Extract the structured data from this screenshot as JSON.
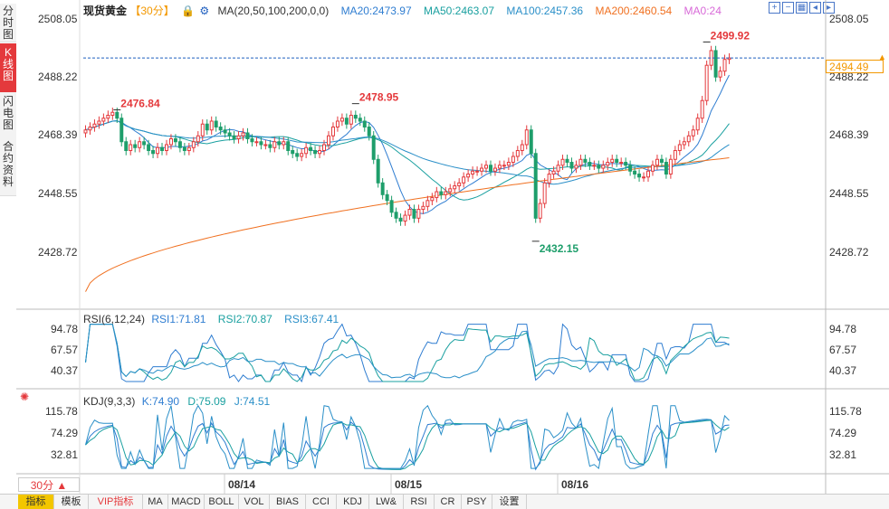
{
  "tabs": {
    "vertical": [
      {
        "label": "分时图",
        "active": false
      },
      {
        "label": "K线图",
        "active": true
      },
      {
        "label": "闪电图",
        "active": false
      },
      {
        "label": "合约资料",
        "active": false
      }
    ]
  },
  "main_legend": {
    "title": "现货黄金",
    "period": "【30分】",
    "ma_params": "MA(20,50,100,200,0,0)",
    "ma20": "MA20:2473.97",
    "ma50": "MA50:2463.07",
    "ma100": "MA100:2457.36",
    "ma200": "MA200:2460.54",
    "ma0": "MA0:24"
  },
  "rsi_legend": {
    "name": "RSI(6,12,24)",
    "rsi1": "RSI1:71.81",
    "rsi2": "RSI2:70.87",
    "rsi3": "RSI3:67.41"
  },
  "kdj_legend": {
    "name": "KDJ(9,3,3)",
    "k": "K:74.90",
    "d": "D:75.09",
    "j": "J:74.51"
  },
  "current_price": "2494.49",
  "period_button": "30分 ▲",
  "bottom_tabs": [
    "指标",
    "模板",
    "VIP指标",
    "MA",
    "MACD",
    "BOLL",
    "VOL",
    "BIAS",
    "CCI",
    "KDJ",
    "LW&",
    "RSI",
    "CR",
    "PSY",
    "设置"
  ],
  "colors": {
    "up": "#e4393c",
    "down": "#1e9e6b",
    "ma20": "#2f7dd1",
    "ma50": "#1aa0a0",
    "ma100": "#2a8fc8",
    "ma200": "#f07020",
    "price_line": "#1f5fbf",
    "accent": "#f39800"
  },
  "chart_data": [
    {
      "type": "candlestick",
      "title": "现货黄金 【30分】",
      "yaxis_ticks": [
        "2508.05",
        "2488.22",
        "2468.39",
        "2448.55",
        "2428.72"
      ],
      "ylim": [
        2415,
        2510
      ],
      "xaxis_ticks": [
        "08/14",
        "08/15",
        "08/16"
      ],
      "annotations": [
        {
          "label": "2476.84",
          "value": 2476.84,
          "type": "high"
        },
        {
          "label": "2478.95",
          "value": 2478.95,
          "type": "high"
        },
        {
          "label": "2432.15",
          "value": 2432.15,
          "type": "low"
        },
        {
          "label": "2499.92",
          "value": 2499.92,
          "type": "high"
        }
      ],
      "current_price": 2494.49,
      "closes": [
        2470,
        2471,
        2472,
        2473,
        2474,
        2475,
        2476,
        2474,
        2466,
        2463,
        2465,
        2464,
        2466,
        2465,
        2463,
        2462,
        2464,
        2463,
        2465,
        2467,
        2466,
        2464,
        2463,
        2464,
        2466,
        2468,
        2472,
        2470,
        2473,
        2471,
        2470,
        2469,
        2468,
        2467,
        2468,
        2469,
        2467,
        2466,
        2466,
        2465,
        2465,
        2464,
        2466,
        2465,
        2466,
        2463,
        2462,
        2461,
        2462,
        2464,
        2463,
        2462,
        2463,
        2465,
        2468,
        2471,
        2473,
        2474,
        2472,
        2475,
        2474,
        2473,
        2471,
        2468,
        2460,
        2452,
        2448,
        2446,
        2442,
        2440,
        2439,
        2441,
        2443,
        2440,
        2443,
        2444,
        2446,
        2447,
        2449,
        2448,
        2449,
        2450,
        2451,
        2452,
        2454,
        2455,
        2456,
        2456,
        2457,
        2458,
        2456,
        2457,
        2458,
        2458,
        2459,
        2461,
        2463,
        2465,
        2470,
        2462,
        2440,
        2445,
        2452,
        2455,
        2456,
        2458,
        2460,
        2459,
        2457,
        2458,
        2460,
        2459,
        2458,
        2458,
        2457,
        2458,
        2459,
        2460,
        2459,
        2459,
        2458,
        2456,
        2455,
        2454,
        2454,
        2456,
        2458,
        2460,
        2459,
        2455,
        2460,
        2463,
        2465,
        2466,
        2468,
        2470,
        2474,
        2480,
        2492,
        2497,
        2488,
        2490,
        2494,
        2494.49
      ]
    },
    {
      "type": "line",
      "title": "RSI(6,12,24)",
      "yaxis_ticks": [
        "94.78",
        "67.57",
        "40.37"
      ],
      "ylim": [
        25,
        105
      ],
      "series": [
        {
          "name": "RSI1",
          "latest": 71.81
        },
        {
          "name": "RSI2",
          "latest": 70.87
        },
        {
          "name": "RSI3",
          "latest": 67.41
        }
      ]
    },
    {
      "type": "line",
      "title": "KDJ(9,3,3)",
      "yaxis_ticks": [
        "115.78",
        "74.29",
        "32.81"
      ],
      "ylim": [
        5,
        125
      ],
      "series": [
        {
          "name": "K",
          "latest": 74.9
        },
        {
          "name": "D",
          "latest": 75.09
        },
        {
          "name": "J",
          "latest": 74.51
        }
      ]
    }
  ]
}
